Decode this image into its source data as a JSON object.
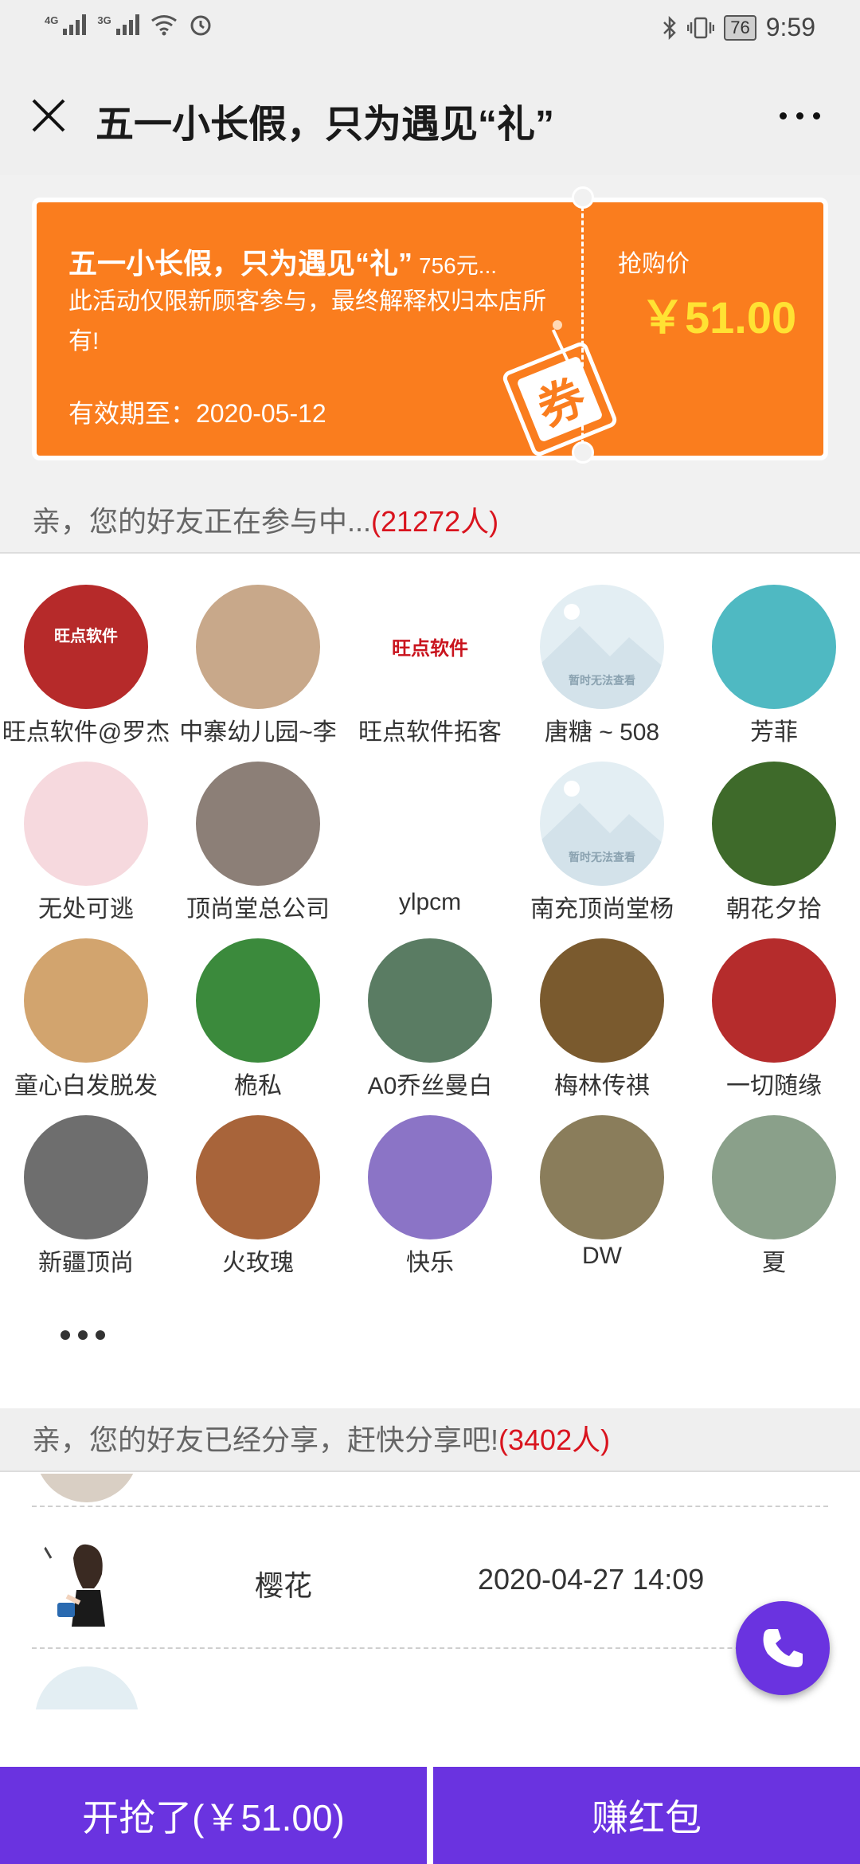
{
  "status_bar": {
    "time": "9:59",
    "battery": "76",
    "net1": "4G",
    "net2": "3G"
  },
  "header": {
    "title": "五一小长假，只为遇见“礼”"
  },
  "coupon": {
    "title": "五一小长假，只为遇见“礼”",
    "subtitle": "756元...",
    "description": "此活动仅限新顾客参与，最终解释权归本店所有!",
    "validity": "有效期至：2020-05-12",
    "price_label": "抢购价",
    "price": "￥51.00",
    "stamp": "券"
  },
  "participating": {
    "label": "亲，您的好友正在参与中...",
    "count": "(21272人)",
    "friends": [
      {
        "name": "旺点软件@罗杰",
        "color": "#b62a2a",
        "image_text": "旺点软件"
      },
      {
        "name": "中寨幼儿园~李",
        "color": "#c8a88a"
      },
      {
        "name": "旺点软件拓客",
        "color": "#ffffff",
        "image_text": "旺点软件"
      },
      {
        "name": "唐糖 ~ 508",
        "color": "#e3eef3",
        "image_text": "暂时无法查看"
      },
      {
        "name": "芳菲",
        "color": "#4fb9c2"
      },
      {
        "name": "无处可逃",
        "color": "#f6d9de"
      },
      {
        "name": "顶尚堂总公司",
        "color": "#8c7f77"
      },
      {
        "name": "ylpcm",
        "color": "#ffffff"
      },
      {
        "name": "南充顶尚堂杨",
        "color": "#e3eef3",
        "image_text": "暂时无法查看"
      },
      {
        "name": "朝花夕拾",
        "color": "#3e6a2a"
      },
      {
        "name": "童心白发脱发",
        "color": "#d2a46e"
      },
      {
        "name": "桅私",
        "color": "#3b8a3c"
      },
      {
        "name": "A0乔丝曼白",
        "color": "#5a7c63"
      },
      {
        "name": "梅林传祺",
        "color": "#7a5a2e"
      },
      {
        "name": "一切随缘",
        "color": "#b52c2c"
      },
      {
        "name": "新疆顶尚",
        "color": "#6e6e6e"
      },
      {
        "name": "火玫瑰",
        "color": "#a8643a"
      },
      {
        "name": "快乐",
        "color": "#8b74c6"
      },
      {
        "name": "DW",
        "color": "#8a7d5b"
      },
      {
        "name": "夏",
        "color": "#8aa08a"
      }
    ]
  },
  "shared": {
    "label": "亲，您的好友已经分享，赶快分享吧!",
    "count": "(3402人)",
    "items": [
      {
        "name": "樱花",
        "time": "2020-04-27 14:09",
        "color": "#ffffff"
      }
    ]
  },
  "bottom": {
    "buy_label": "开抢了(￥51.00)",
    "earn_label": "赚红包"
  },
  "colors": {
    "accent": "#6a33e0",
    "coupon": "#fa7d1e",
    "price": "#ffe233",
    "count": "#d9141e"
  }
}
